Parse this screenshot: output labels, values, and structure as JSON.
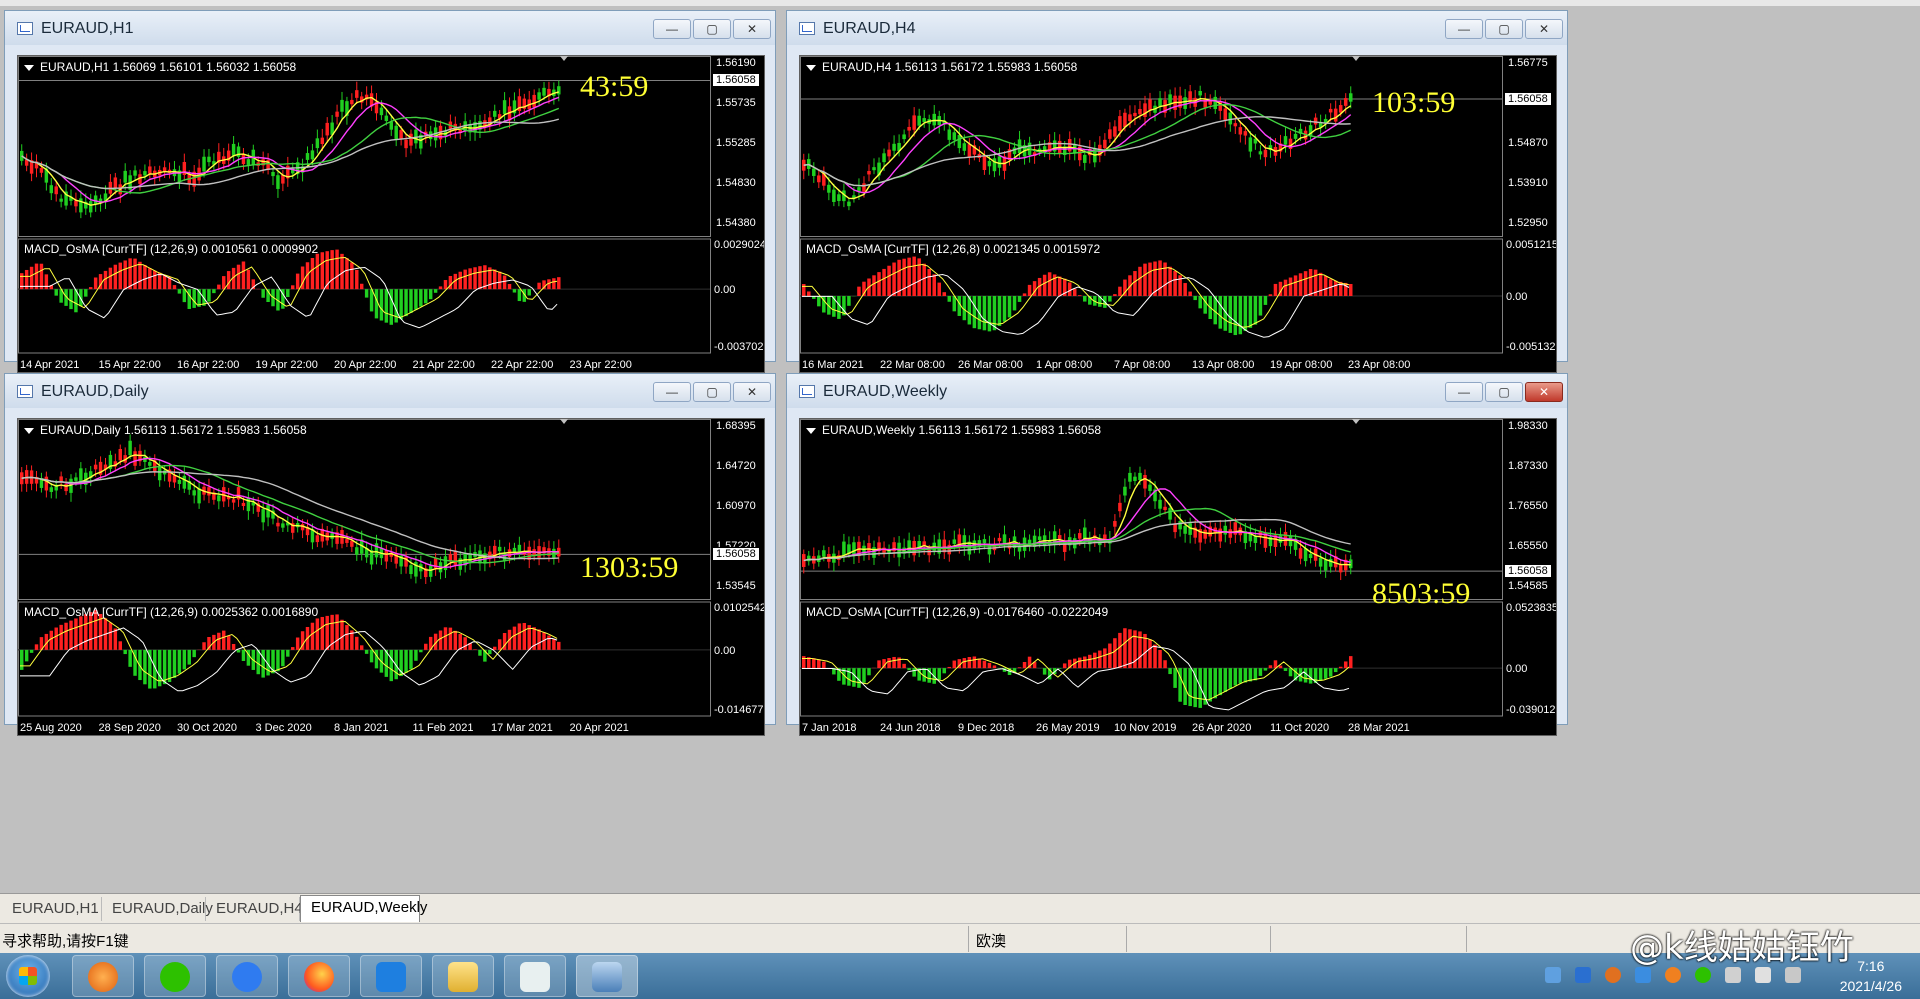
{
  "windows": [
    {
      "title": "EURAUD,H1",
      "header": "EURAUD,H1  1.56069 1.56101 1.56032 1.56058",
      "timer": "43:59",
      "price_labels": [
        "1.56190",
        "1.55735",
        "1.55285",
        "1.54830",
        "1.54380"
      ],
      "current_price": "1.56058",
      "current_frac": 0.11,
      "indicator_header": "MACD_OsMA [CurrTF] (12,26,9) 0.0010561 0.0009902",
      "ind_labels": [
        "0.0029024",
        "0.00",
        "-0.0037028"
      ],
      "ind_zero_frac": 0.44,
      "dates": [
        "14 Apr 2021",
        "15 Apr 22:00",
        "16 Apr 22:00",
        "19 Apr 22:00",
        "20 Apr 22:00",
        "21 Apr 22:00",
        "22 Apr 22:00",
        "23 Apr 22:00"
      ],
      "trend": [
        0.55,
        0.7,
        0.85,
        0.9,
        0.8,
        0.72,
        0.68,
        0.65,
        0.7,
        0.58,
        0.55,
        0.6,
        0.72,
        0.66,
        0.45,
        0.25,
        0.15,
        0.35,
        0.48,
        0.42,
        0.38,
        0.35,
        0.3,
        0.25,
        0.18,
        0.12
      ],
      "hist": [
        0.4,
        0.7,
        -0.3,
        -0.6,
        0.3,
        0.6,
        0.8,
        0.5,
        0.3,
        -0.5,
        -0.4,
        0.4,
        0.7,
        -0.2,
        -0.6,
        0.5,
        0.9,
        1.0,
        0.6,
        -0.7,
        -0.9,
        -0.6,
        -0.3,
        0.3,
        0.5,
        0.6,
        0.4,
        -0.4,
        0.2,
        0.3
      ],
      "close_active": false
    },
    {
      "title": "EURAUD,H4",
      "header": "EURAUD,H4  1.56113 1.56172 1.55983 1.56058",
      "timer": "103:59",
      "price_labels": [
        "1.56775",
        "1.55830",
        "1.54870",
        "1.53910",
        "1.52950"
      ],
      "current_price": "1.56058",
      "current_frac": 0.22,
      "indicator_header": "MACD_OsMA [CurrTF] (12,26,8) 0.0021345 0.0015972",
      "ind_labels": [
        "0.0051215",
        "0.00",
        "-0.0051325"
      ],
      "ind_zero_frac": 0.5,
      "dates": [
        "16 Mar 2021",
        "22 Mar 08:00",
        "26 Mar 08:00",
        "1 Apr 08:00",
        "7 Apr 08:00",
        "13 Apr 08:00",
        "19 Apr 08:00",
        "23 Apr 08:00"
      ],
      "trend": [
        0.62,
        0.75,
        0.88,
        0.7,
        0.55,
        0.35,
        0.3,
        0.45,
        0.58,
        0.62,
        0.52,
        0.55,
        0.5,
        0.58,
        0.45,
        0.3,
        0.25,
        0.2,
        0.18,
        0.22,
        0.4,
        0.55,
        0.48,
        0.4,
        0.3,
        0.2
      ],
      "hist": [
        0.3,
        -0.4,
        -0.6,
        0.3,
        0.6,
        0.9,
        1.0,
        0.5,
        -0.4,
        -0.8,
        -0.9,
        -0.5,
        0.3,
        0.6,
        0.4,
        -0.2,
        -0.3,
        0.4,
        0.8,
        0.9,
        0.5,
        -0.3,
        -0.8,
        -1.0,
        -0.7,
        0.3,
        0.5,
        0.7,
        0.4,
        0.3
      ],
      "close_active": false
    },
    {
      "title": "EURAUD,Daily",
      "header": "EURAUD,Daily  1.56113 1.56172 1.55983 1.56058",
      "timer": "1303:59",
      "price_labels": [
        "1.68395",
        "1.64720",
        "1.60970",
        "1.57220",
        "1.53545"
      ],
      "current_price": "1.56058",
      "current_frac": 0.77,
      "indicator_header": "MACD_OsMA [CurrTF] (12,26,9) 0.0025362 0.0016890",
      "ind_labels": [
        "0.0102542",
        "0.00",
        "-0.0146778"
      ],
      "ind_zero_frac": 0.42,
      "dates": [
        "25 Aug 2020",
        "28 Sep 2020",
        "30 Oct 2020",
        "3 Dec 2020",
        "8 Jan 2021",
        "11 Feb 2021",
        "17 Mar 2021",
        "20 Apr 2021"
      ],
      "trend": [
        0.3,
        0.35,
        0.33,
        0.28,
        0.22,
        0.12,
        0.2,
        0.3,
        0.38,
        0.4,
        0.42,
        0.5,
        0.58,
        0.62,
        0.68,
        0.72,
        0.78,
        0.82,
        0.88,
        0.9,
        0.85,
        0.82,
        0.8,
        0.78,
        0.76,
        0.77
      ],
      "hist": [
        -0.5,
        0.3,
        0.6,
        0.8,
        1.0,
        0.6,
        -0.6,
        -1.0,
        -0.8,
        -0.4,
        0.3,
        0.5,
        -0.3,
        -0.7,
        -0.5,
        0.4,
        0.8,
        0.9,
        0.4,
        -0.4,
        -0.8,
        -0.5,
        0.3,
        0.6,
        0.3,
        -0.3,
        0.4,
        0.7,
        0.5,
        0.2
      ],
      "close_active": false
    },
    {
      "title": "EURAUD,Weekly",
      "header": "EURAUD,Weekly  1.56113 1.56172 1.55983 1.56058",
      "timer": "8503:59",
      "price_labels": [
        "1.98330",
        "1.87330",
        "1.76550",
        "1.65550",
        "1.54585"
      ],
      "current_price": "1.56058",
      "current_frac": 0.87,
      "indicator_header": "MACD_OsMA [CurrTF] (12,26,9) -0.0176460 -0.0222049",
      "ind_labels": [
        "0.0523835",
        "0.00",
        "-0.0390127"
      ],
      "ind_zero_frac": 0.58,
      "dates": [
        "7 Jan 2018",
        "24 Jun 2018",
        "9 Dec 2018",
        "26 May 2019",
        "10 Nov 2019",
        "26 Apr 2020",
        "11 Oct 2020",
        "28 Mar 2021"
      ],
      "trend": [
        0.85,
        0.8,
        0.78,
        0.75,
        0.77,
        0.74,
        0.76,
        0.73,
        0.75,
        0.72,
        0.74,
        0.7,
        0.72,
        0.69,
        0.7,
        0.25,
        0.4,
        0.6,
        0.68,
        0.66,
        0.65,
        0.68,
        0.72,
        0.78,
        0.85,
        0.88
      ],
      "hist": [
        0.3,
        0.2,
        -0.4,
        -0.5,
        0.2,
        0.3,
        -0.3,
        -0.4,
        0.2,
        0.3,
        0.1,
        -0.2,
        0.3,
        -0.3,
        0.2,
        0.3,
        0.5,
        1.0,
        0.9,
        0.4,
        -0.9,
        -1.0,
        -0.7,
        -0.4,
        -0.3,
        0.2,
        -0.3,
        -0.4,
        -0.2,
        0.3
      ],
      "close_active": true
    }
  ],
  "tabs": [
    "EURAUD,H1",
    "EURAUD,Daily",
    "EURAUD,H4",
    "EURAUD,Weekly"
  ],
  "active_tab": 3,
  "status": {
    "help": "寻求帮助,请按F1键",
    "symbol": "欧澳"
  },
  "clock": {
    "time": "7:16",
    "date": "2021/4/26"
  },
  "watermark": "@k线姑姑钰竹",
  "colors": {
    "bull": "#ff2020",
    "bear": "#20d020",
    "ma_yellow": "#ffff40",
    "ma_magenta": "#ff40ff",
    "ma_green": "#40d040",
    "ma_gray": "#c0c0c0",
    "timer": "#ffff33"
  }
}
